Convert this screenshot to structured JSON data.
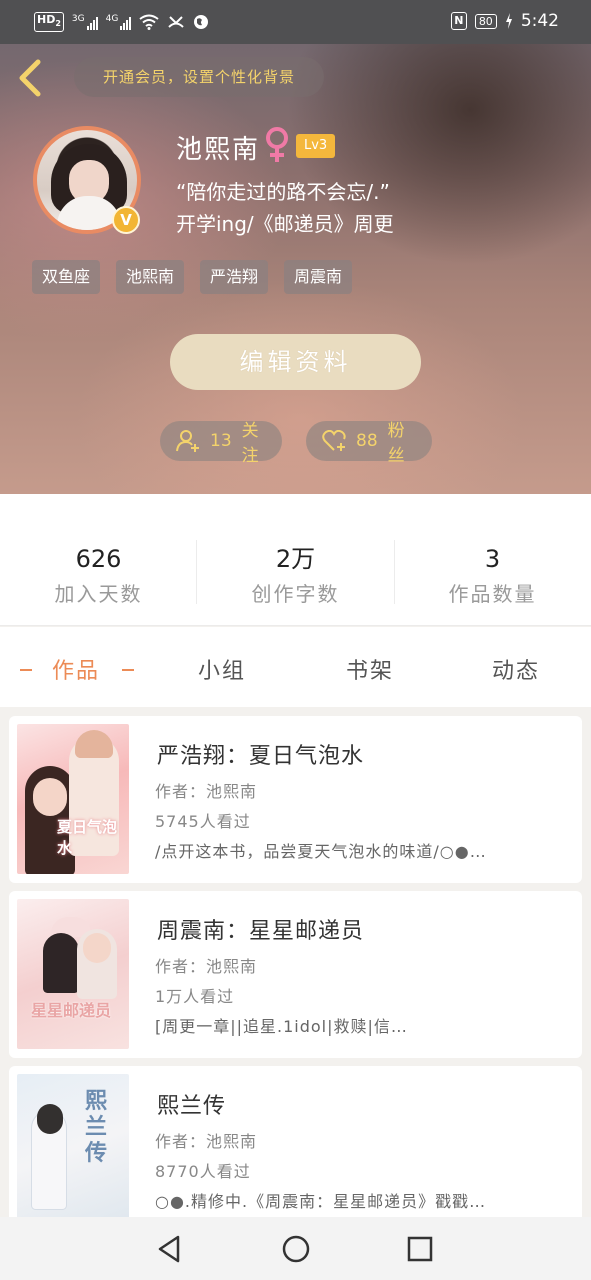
{
  "status_bar": {
    "hd_label": "HD",
    "hd_sub": "2",
    "sig1_label": "3G",
    "sig2_label": "4G",
    "nfc_label": "N",
    "battery": "80",
    "time": "5:42"
  },
  "header": {
    "back_icon": "chevron-left-icon",
    "vip_banner": "开通会员，设置个性化背景"
  },
  "profile": {
    "username": "池熙南",
    "gender_icon": "female-icon",
    "level": "Lv3",
    "verified_badge": "V",
    "bio_line1": "“陪你走过的路不会忘/.”",
    "bio_line2": "开学ing/《邮递员》周更",
    "tags": [
      "双鱼座",
      "池熙南",
      "严浩翔",
      "周震南"
    ],
    "edit_button": "编辑资料",
    "follow_count": "13",
    "follow_label": "关注",
    "fans_count": "88",
    "fans_label": "粉丝"
  },
  "stats": [
    {
      "value": "626",
      "label": "加入天数"
    },
    {
      "value": "2万",
      "label": "创作字数"
    },
    {
      "value": "3",
      "label": "作品数量"
    }
  ],
  "tabs": [
    "作品",
    "小组",
    "书架",
    "动态"
  ],
  "active_tab": "作品",
  "works": [
    {
      "title": "严浩翔：夏日气泡水",
      "author": "作者：池熙南",
      "views": "5745人看过",
      "desc": "/点开这本书，品尝夏天气泡水的味道/○●…",
      "cover_text": "夏日气泡水"
    },
    {
      "title": "周震南：星星邮递员",
      "author": "作者：池熙南",
      "views": "1万人看过",
      "desc": "[周更一章||追星.1idol|救赎|信…",
      "cover_text": "星星邮递员"
    },
    {
      "title": "熙兰传",
      "author": "作者：池熙南",
      "views": "8770人看过",
      "desc": "○●.精修中.《周震南：星星邮递员》戳戳…",
      "cover_text": "熙兰传"
    }
  ],
  "nav": {
    "back": "triangle-back-icon",
    "home": "circle-home-icon",
    "recents": "square-recents-icon"
  },
  "colors": {
    "accent": "#ec8b56",
    "gold": "#f4d36b",
    "level_badge": "#f4b73c",
    "edit_button": "#e9dcc0"
  }
}
